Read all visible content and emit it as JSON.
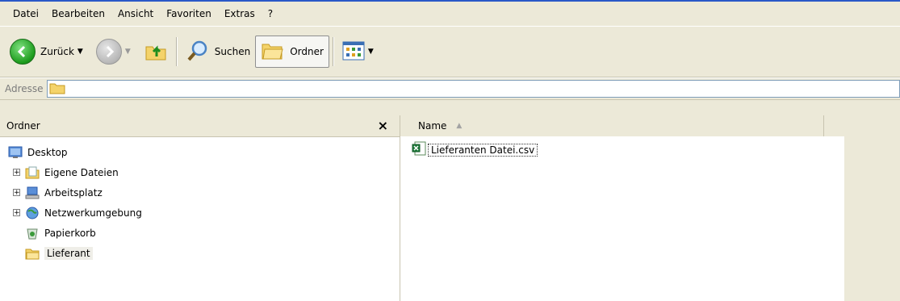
{
  "menu": [
    "Datei",
    "Bearbeiten",
    "Ansicht",
    "Favoriten",
    "Extras",
    "?"
  ],
  "toolbar": {
    "back_label": "Zurück",
    "search_label": "Suchen",
    "folders_label": "Ordner"
  },
  "address": {
    "label": "Adresse",
    "value": ""
  },
  "folders_pane": {
    "title": "Ordner",
    "close": "×",
    "items": [
      {
        "label": "Desktop",
        "icon": "desktop-icon",
        "expandable": false,
        "indent": 0
      },
      {
        "label": "Eigene Dateien",
        "icon": "documents-folder-icon",
        "expandable": true,
        "indent": 1
      },
      {
        "label": "Arbeitsplatz",
        "icon": "my-computer-icon",
        "expandable": true,
        "indent": 1
      },
      {
        "label": "Netzwerkumgebung",
        "icon": "network-icon",
        "expandable": true,
        "indent": 1
      },
      {
        "label": "Papierkorb",
        "icon": "recycle-bin-icon",
        "expandable": false,
        "indent": 1
      },
      {
        "label": "Lieferant",
        "icon": "folder-icon",
        "expandable": false,
        "indent": 1,
        "selected": true
      }
    ]
  },
  "file_list": {
    "column_name": "Name",
    "files": [
      {
        "name": "Lieferanten Datei.csv",
        "icon": "excel-csv-icon"
      }
    ]
  },
  "colors": {
    "window_bg": "#ece9d8",
    "title_border": "#2a58c8",
    "address_border": "#7f9db9"
  }
}
